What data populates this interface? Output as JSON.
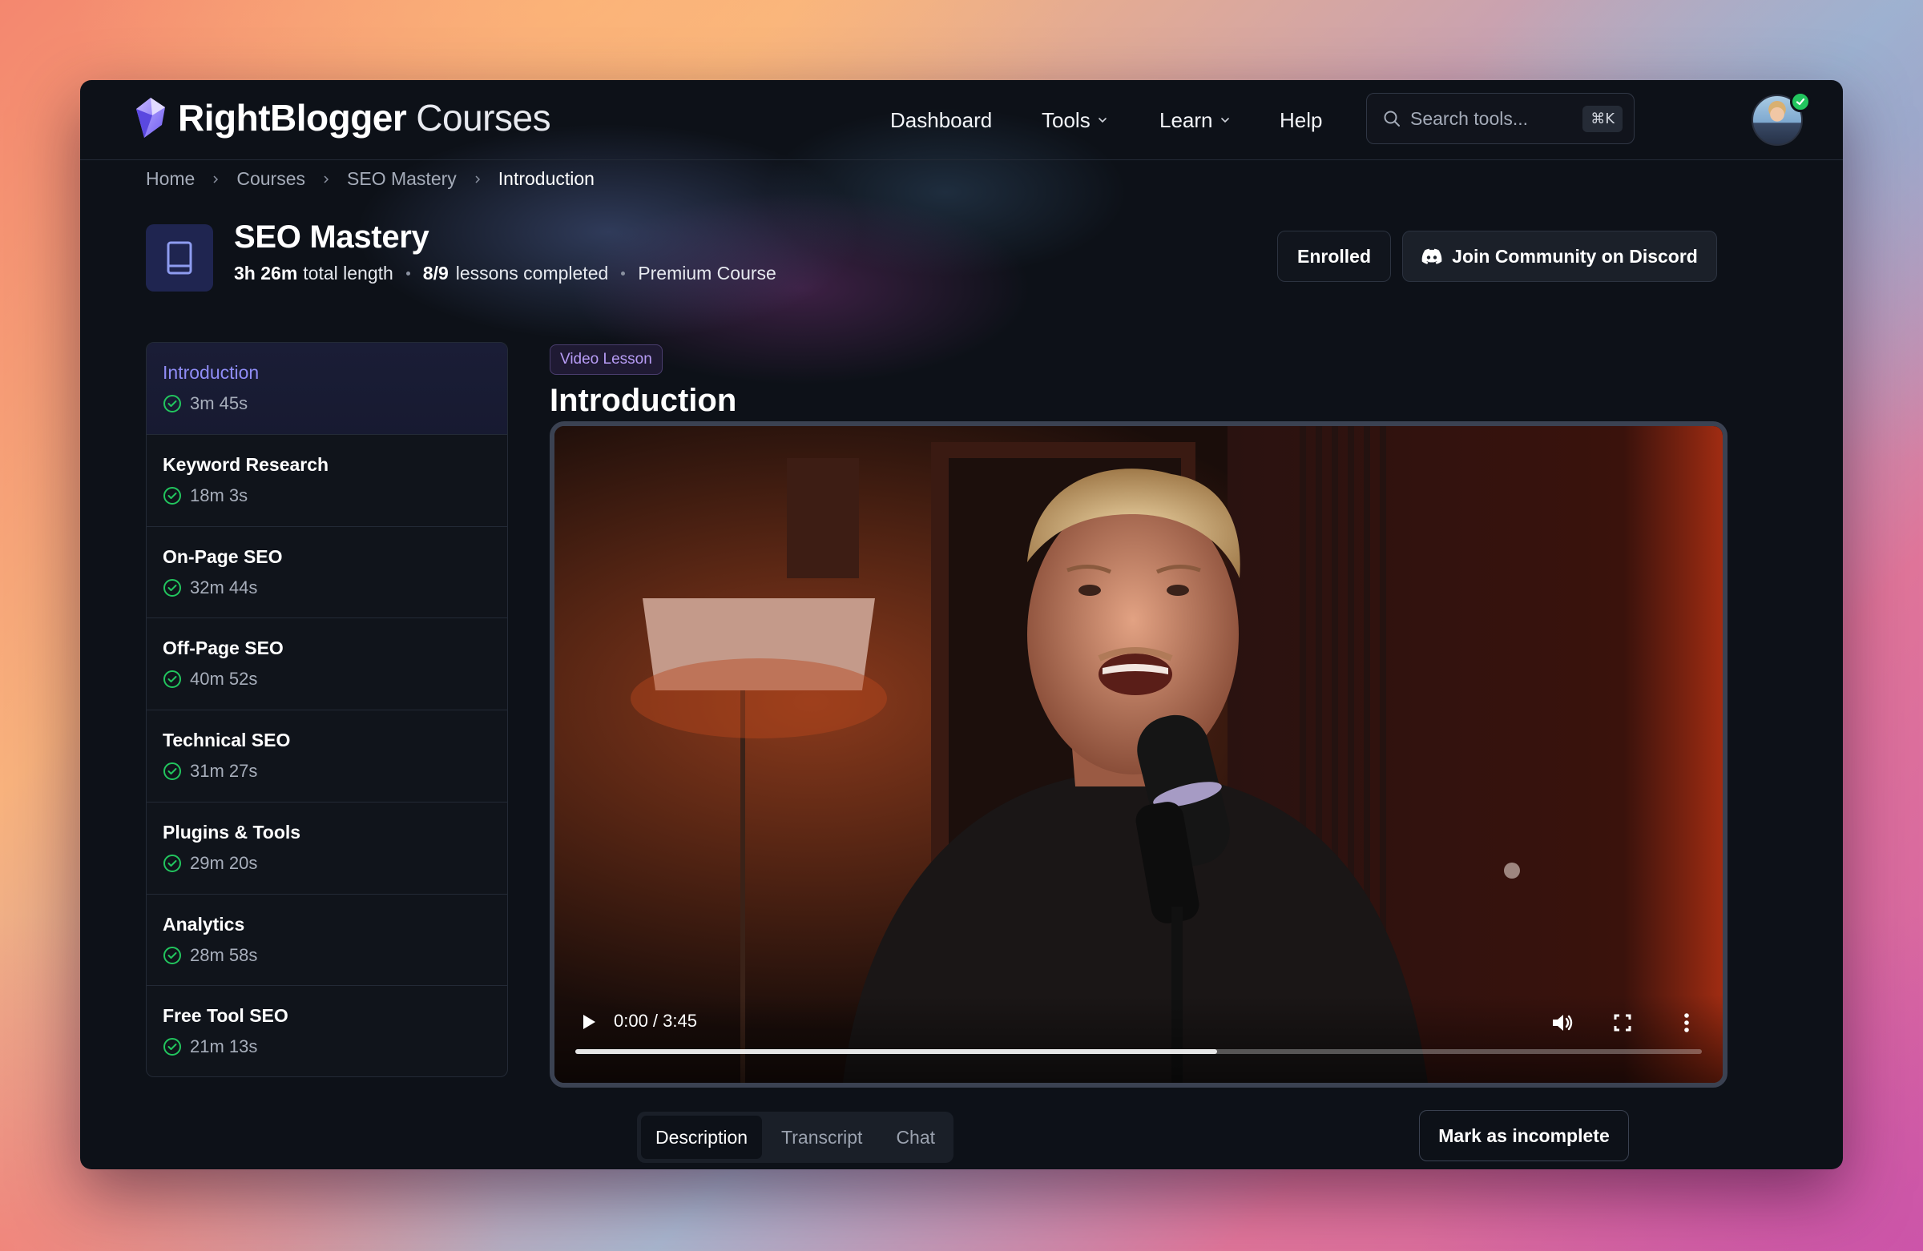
{
  "brand": {
    "name": "RightBlogger",
    "sub": "Courses"
  },
  "nav": [
    {
      "label": "Dashboard",
      "dropdown": false
    },
    {
      "label": "Tools",
      "dropdown": true
    },
    {
      "label": "Learn",
      "dropdown": true
    },
    {
      "label": "Help",
      "dropdown": false
    }
  ],
  "search": {
    "placeholder": "Search tools...",
    "shortcut": "⌘K"
  },
  "breadcrumb": [
    "Home",
    "Courses",
    "SEO Mastery",
    "Introduction"
  ],
  "course": {
    "title": "SEO Mastery",
    "length_value": "3h 26m",
    "length_label": "total length",
    "completed_value": "8/9",
    "completed_label": "lessons completed",
    "tier": "Premium Course",
    "enrolled_label": "Enrolled",
    "discord_label": "Join Community on Discord"
  },
  "lessons": [
    {
      "title": "Introduction",
      "duration": "3m 45s",
      "active": true
    },
    {
      "title": "Keyword Research",
      "duration": "18m 3s"
    },
    {
      "title": "On-Page SEO",
      "duration": "32m 44s"
    },
    {
      "title": "Off-Page SEO",
      "duration": "40m 52s"
    },
    {
      "title": "Technical SEO",
      "duration": "31m 27s"
    },
    {
      "title": "Plugins & Tools",
      "duration": "29m 20s"
    },
    {
      "title": "Analytics",
      "duration": "28m 58s"
    },
    {
      "title": "Free Tool SEO",
      "duration": "21m 13s"
    }
  ],
  "lesson": {
    "tag": "Video Lesson",
    "title": "Introduction",
    "video": {
      "time": "0:00 / 3:45",
      "buffered_fraction": 0.57
    }
  },
  "tabs": [
    {
      "label": "Description",
      "active": true
    },
    {
      "label": "Transcript"
    },
    {
      "label": "Chat"
    }
  ],
  "mark_incomplete_label": "Mark as incomplete",
  "colors": {
    "accent": "#8f8cf5",
    "complete": "#22c55e",
    "window_bg": "#0d1118",
    "tag": "#b79cf5"
  }
}
